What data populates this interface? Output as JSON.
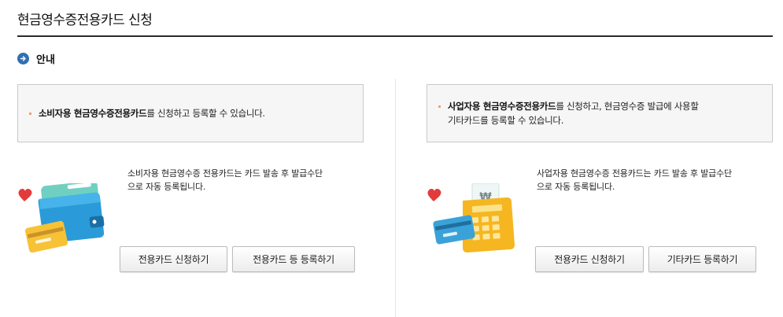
{
  "page": {
    "title": "현금영수증전용카드 신청"
  },
  "section": {
    "label": "안내"
  },
  "left": {
    "info_bold": "소비자용 현금영수증전용카드",
    "info_rest": "를 신청하고 등록할 수 있습니다.",
    "desc_line1": "소비자용 현금영수증 전용카드는 카드 발송 후 발급수단",
    "desc_line2": "으로 자동 등록됩니다.",
    "btn_apply": "전용카드 신청하기",
    "btn_register": "전용카드 등 등록하기"
  },
  "right": {
    "info_bold": "사업자용 현금영수증전용카드",
    "info_rest1": "를 신청하고, 현금영수증 발급에 사용할",
    "info_line2": "기타카드를 등록할 수 있습니다.",
    "desc_line1": "사업자용 현금영수증 전용카드는 카드 발송 후 발급수단",
    "desc_line2": "으로 자동 등록됩니다.",
    "btn_apply": "전용카드 신청하기",
    "btn_register": "기타카드 등록하기"
  },
  "icons": {
    "section": "arrow-circle-icon",
    "left_illustration": "wallet-card-illustration",
    "right_illustration": "receipt-machine-illustration"
  },
  "colors": {
    "accent": "#2f6fb3",
    "bullet": "#f0a072",
    "heart": "#e23b3b"
  }
}
